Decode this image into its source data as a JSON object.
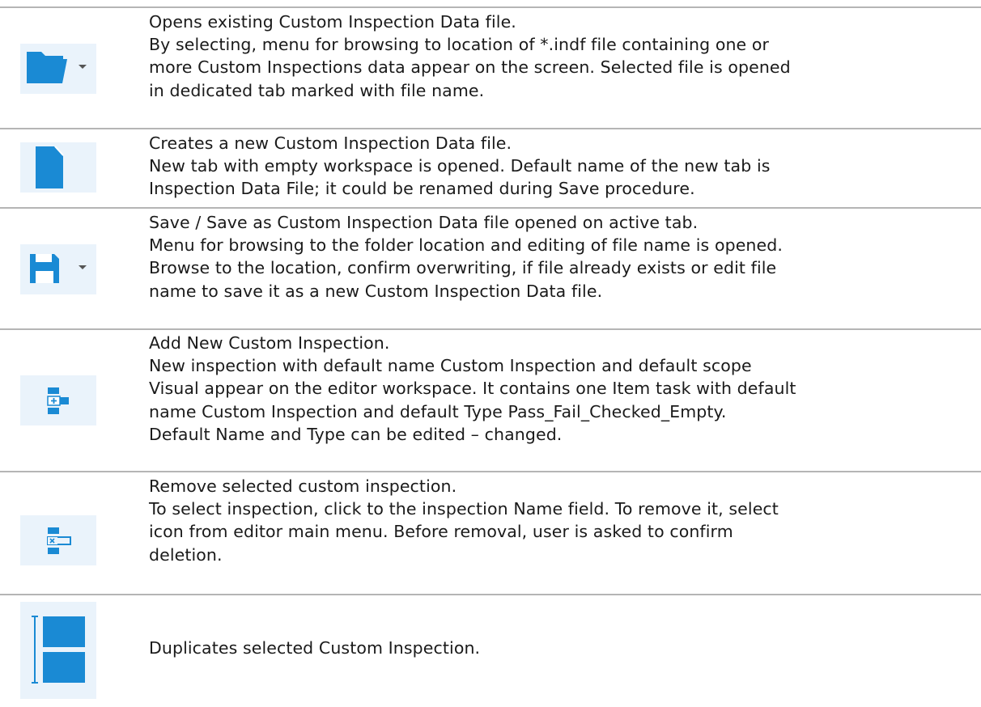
{
  "rows": [
    {
      "icon": "folder-open-dropdown-icon",
      "lines": [
        "Opens existing Custom Inspection Data file.",
        "By selecting, menu for browsing to location of *.indf file containing one or",
        "more Custom Inspections data appear on the screen. Selected file is opened",
        "in dedicated tab marked with file name."
      ]
    },
    {
      "icon": "new-file-icon",
      "lines": [
        "Creates a new Custom Inspection Data file.",
        "New tab with empty workspace is opened. Default name of the new tab is",
        "Inspection Data File; it could be renamed during Save procedure."
      ]
    },
    {
      "icon": "save-dropdown-icon",
      "lines": [
        "Save / Save as Custom Inspection Data file opened on active tab.",
        "Menu for browsing to the folder location and editing of file name is opened.",
        "Browse to the location, confirm overwriting, if file already exists or edit file",
        "name to save it as a new Custom Inspection Data file."
      ]
    },
    {
      "icon": "add-inspection-icon",
      "lines": [
        "Add New Custom Inspection.",
        "New inspection with default name Custom Inspection and default scope",
        "Visual appear on the editor workspace. It contains one Item task with default",
        "name Custom Inspection and default Type Pass_Fail_Checked_Empty.",
        "Default Name and Type can be edited – changed."
      ]
    },
    {
      "icon": "remove-inspection-icon",
      "lines": [
        "Remove selected custom inspection.",
        "To select inspection, click to the inspection Name field. To remove it, select",
        "icon from editor main menu. Before removal, user is asked to confirm",
        "deletion."
      ]
    },
    {
      "icon": "duplicate-inspection-icon",
      "lines": [
        "Duplicates selected Custom Inspection."
      ]
    }
  ],
  "colors": {
    "icon_blue": "#1a8ad4",
    "icon_bg": "#eaf3fb",
    "rule": "#b5b5b5",
    "text": "#1a1a1a"
  }
}
